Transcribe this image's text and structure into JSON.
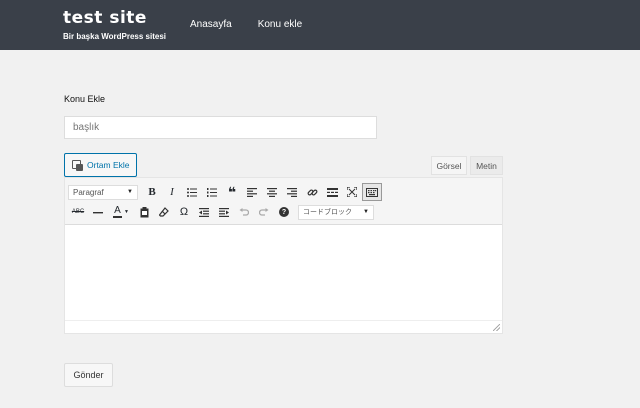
{
  "header": {
    "site_title": "test site",
    "site_description": "Bir başka WordPress sitesi",
    "nav": [
      {
        "label": "Anasayfa"
      },
      {
        "label": "Konu ekle"
      }
    ]
  },
  "form": {
    "label": "Konu Ekle",
    "title_placeholder": "başlık",
    "media_button": "Ortam Ekle",
    "tabs": {
      "visual": "Görsel",
      "text": "Metin"
    },
    "format_select": "Paragraf",
    "code_select": "コードブロック",
    "special_icons": {
      "strikethrough": "ABC",
      "textcolor": "A",
      "charmap": "Ω",
      "help": "?"
    },
    "submit": "Gönder"
  },
  "colors": {
    "header_bg": "#3a4049",
    "page_bg": "#f1f1f1",
    "accent": "#0073aa"
  }
}
